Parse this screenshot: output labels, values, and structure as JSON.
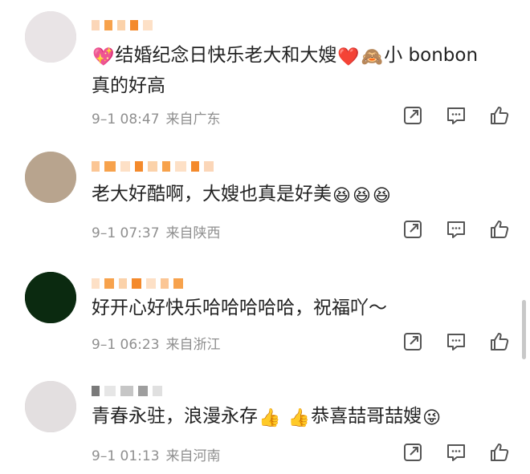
{
  "comments": [
    {
      "text_line1": "结婚纪念日快乐老大和大嫂",
      "mention": "小 bonbon",
      "text_line2": "真的好高",
      "time": "9–1 08:47",
      "location": "来自广东"
    },
    {
      "text_line1": "老大好酷啊，大嫂也真是好美",
      "time": "9–1 07:37",
      "location": "来自陕西"
    },
    {
      "text_line1": "好开心好快乐哈哈哈哈哈，祝福吖～",
      "time": "9–1 06:23",
      "location": "来自浙江"
    },
    {
      "text_line1": "青春永驻，浪漫永存",
      "text_line1b": "恭喜喆哥喆嫂",
      "time": "9–1 01:13",
      "location": "来自河南"
    }
  ],
  "icons": {
    "repost": "repost-icon",
    "reply": "comment-icon",
    "like": "thumbs-up-icon"
  }
}
